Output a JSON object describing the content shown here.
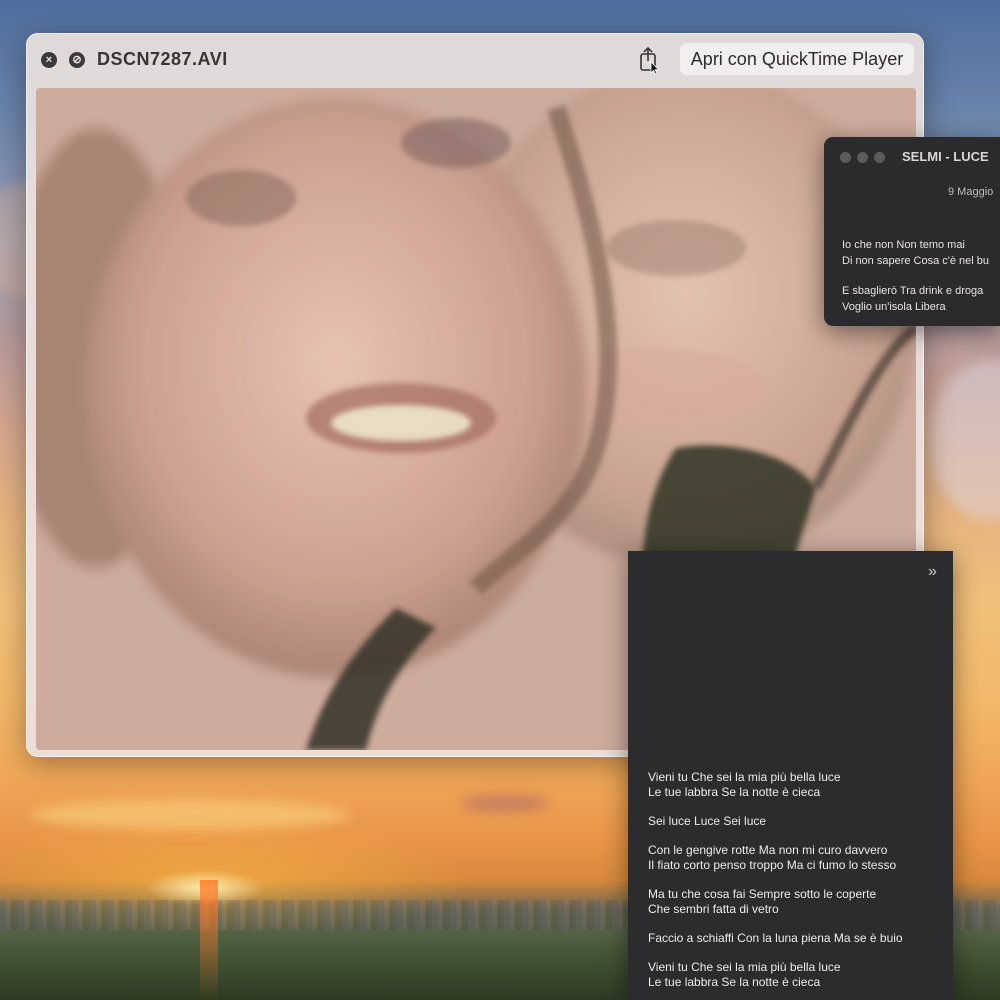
{
  "quicklook": {
    "title": "DSCN7287.AVI",
    "open_with_label": "Apri con QuickTime Player"
  },
  "notes_top": {
    "title": "SELMI - LUCE",
    "date": "9 Maggio",
    "paragraphs": [
      [
        "Io che non Non temo mai",
        "Di non sapere Cosa c'è nel bu"
      ],
      [
        "E sbaglierò Tra drink e droga",
        "Voglio un'isola Libera"
      ]
    ]
  },
  "notes_bottom": {
    "paragraphs": [
      [
        "Vieni tu Che sei la mia più bella luce",
        "Le tue labbra Se la notte è cieca"
      ],
      [
        "Sei luce Luce Sei luce"
      ],
      [
        "Con le gengive rotte Ma non mi curo davvero",
        "Il fiato corto penso troppo Ma ci fumo lo stesso"
      ],
      [
        "Ma tu che cosa fai Sempre sotto le coperte",
        "Che sembri fatta di vetro"
      ],
      [
        "Faccio a schiaffi Con la luna piena Ma se è buio"
      ],
      [
        "Vieni tu Che sei la mia più bella luce",
        "Le tue labbra  Se la notte è cieca"
      ]
    ]
  },
  "icons": {
    "close": "close-icon",
    "block": "block-icon",
    "share": "share-icon",
    "pointer": "mouse-pointer-icon",
    "sidebar": "chevron-double-right-icon"
  }
}
